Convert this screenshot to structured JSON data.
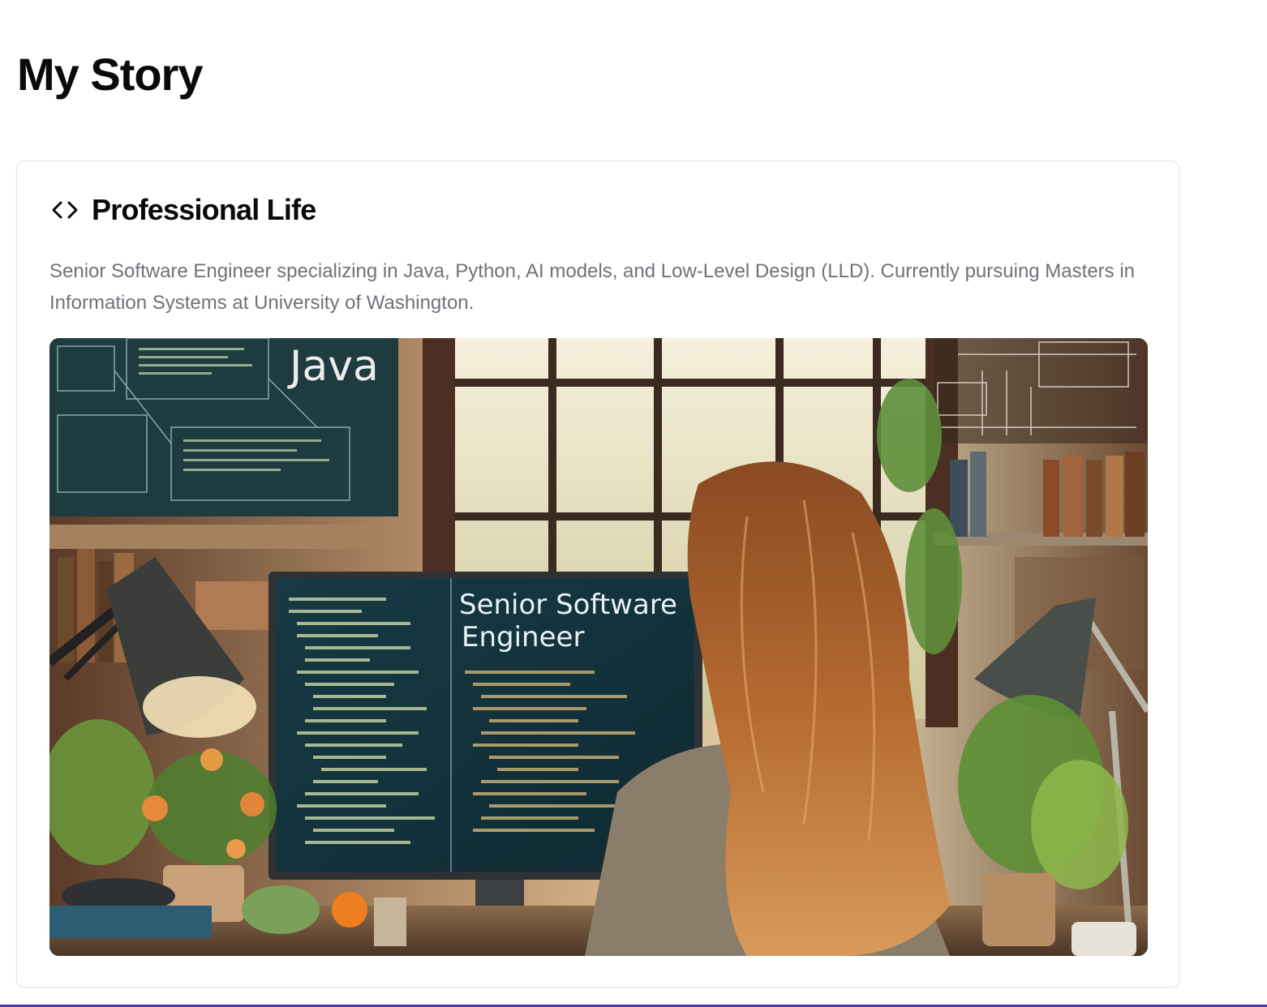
{
  "page": {
    "title": "My Story"
  },
  "card": {
    "icon": "code-icon",
    "title": "Professional Life",
    "description": "Senior Software Engineer specializing in Java, Python, AI models, and Low-Level Design (LLD). Currently pursuing Masters in Information Systems at University of Washington.",
    "image": {
      "subject": "woman-at-computer-illustration",
      "wall_text": "Java",
      "screen_text_line1": "Senior Software",
      "screen_text_line2": "Engineer"
    }
  },
  "colors": {
    "text_primary": "#0a0a0a",
    "text_muted": "#71717a",
    "card_border": "#e4e4e7",
    "bottom_accent": "#4b3fa7"
  }
}
